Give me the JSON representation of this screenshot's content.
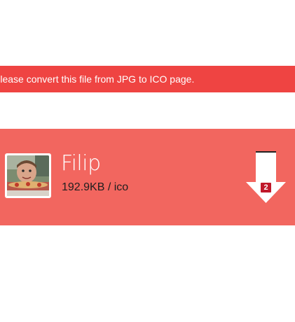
{
  "notice": {
    "text": "Please convert this file from JPG to ICO page."
  },
  "file": {
    "name": "Filip",
    "size": "192.9KB",
    "format": "ico",
    "meta": "192.9KB / ico",
    "thumbnail_icon": "photo-thumbnail-icon",
    "download_icon": "download-arrow-icon",
    "download_count": "2"
  },
  "colors": {
    "notice_bg": "#ef4442",
    "card_bg": "#f2665f",
    "badge_bg": "#c0182a",
    "text_light": "#ffffff",
    "text_dark": "#1f1f1f"
  }
}
